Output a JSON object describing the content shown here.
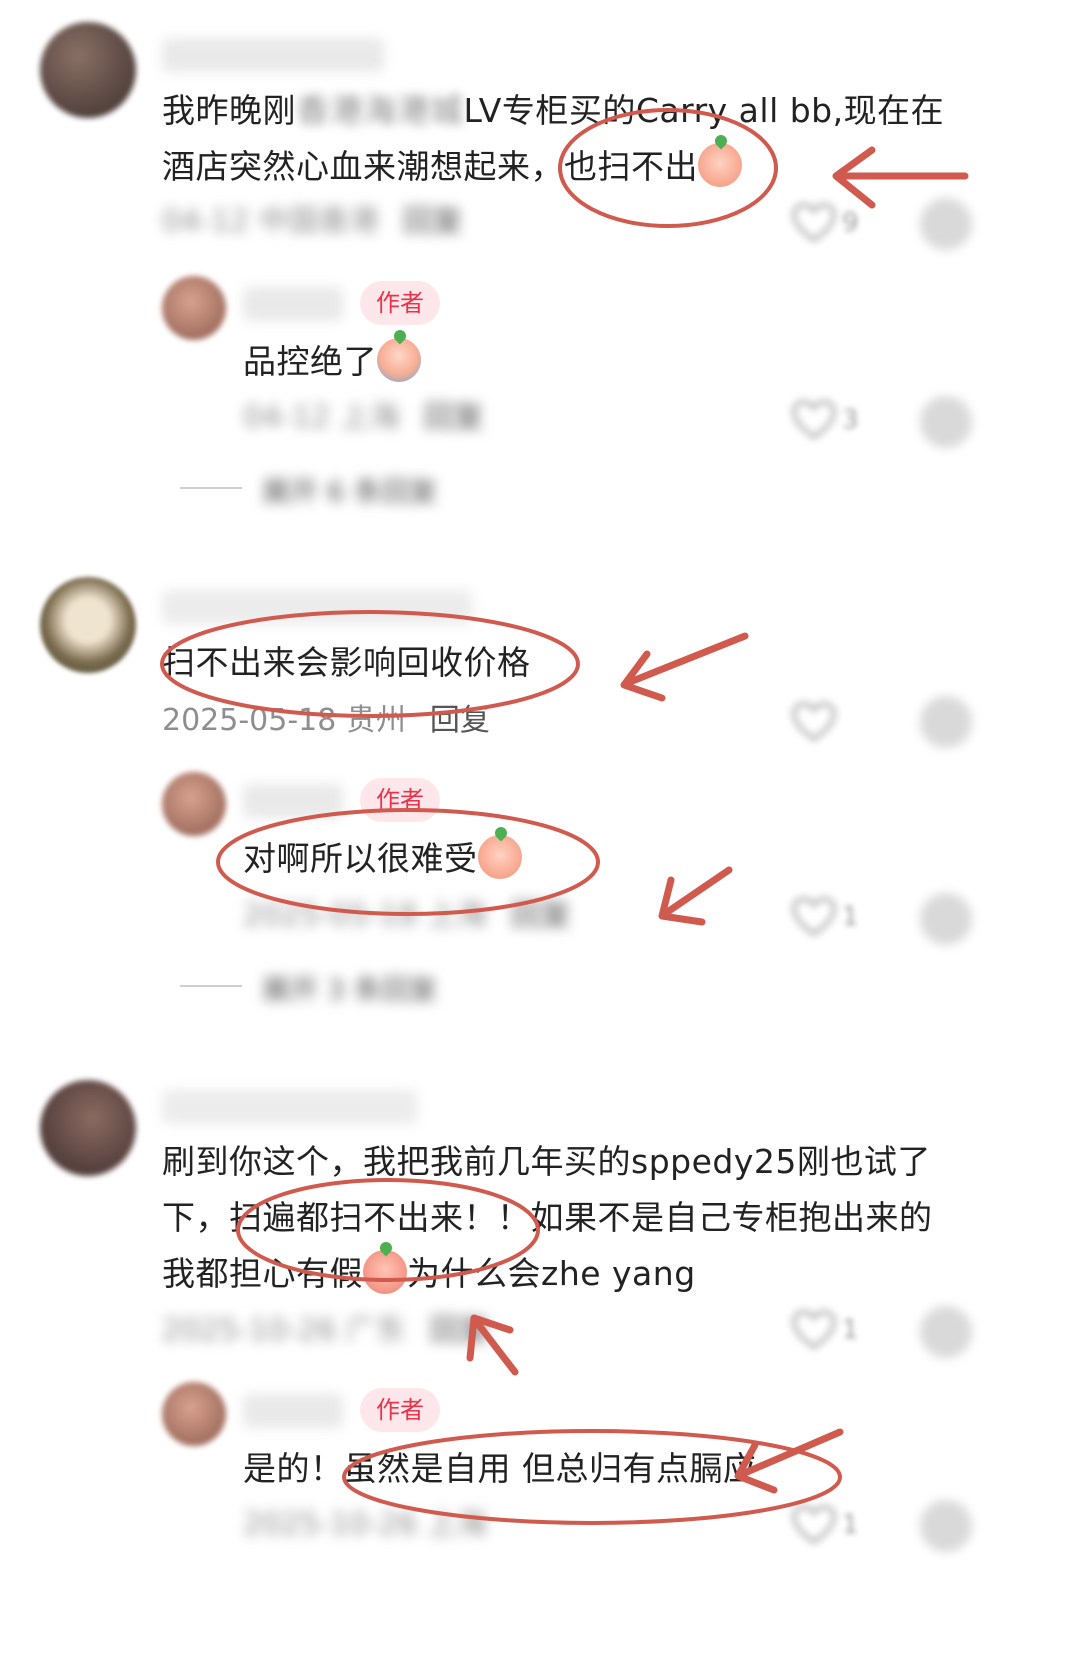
{
  "comments": [
    {
      "text_line1": "我昨晚刚",
      "text_hidden": "香港海港城",
      "text_line1b": "LV专柜买的Carry all bb,现在在",
      "text_line2": "酒店突然心血来潮想起来，也扫不出",
      "meta": "04-12 中国香港",
      "reply_label": "回复",
      "like_count": "9",
      "reply": {
        "author_badge": "作者",
        "text": "品控绝了",
        "meta": "04-12 上海",
        "reply_label": "回复",
        "like_count": "3"
      },
      "expand_text": "展开 6 条回复"
    },
    {
      "text_line1": "扫不出来会影响回收价格",
      "meta_date": "2025-05-18",
      "meta_loc": "贵州",
      "reply_label": "回复",
      "reply": {
        "author_badge": "作者",
        "text": "对啊所以很难受",
        "meta": "2025-05-18 上海",
        "reply_label": "回复",
        "like_count": "1"
      },
      "expand_text": "展开 3 条回复"
    },
    {
      "text_line1": "刷到你这个，我把我前几年买的sppedy25刚也试了",
      "text_line2": "下，扫遍都扫不出来！！如果不是自己专柜抱出来的",
      "text_line3a": "我都担心有假",
      "text_line3b": "为什么会zhe yang",
      "meta": "2025-10-26 广东",
      "reply_label": "回复",
      "like_count": "1",
      "reply": {
        "author_badge": "作者",
        "text": "是的！虽然是自用 但总归有点膈应",
        "meta": "2025-10-26 上海",
        "like_count": "1"
      }
    }
  ],
  "colors": {
    "annotation": "#d05a4e",
    "badge_bg": "#fde7ea",
    "badge_text": "#e8334a"
  },
  "icons": [
    "heart-icon",
    "more-icon",
    "crying-emoji",
    "sad-emoji"
  ]
}
